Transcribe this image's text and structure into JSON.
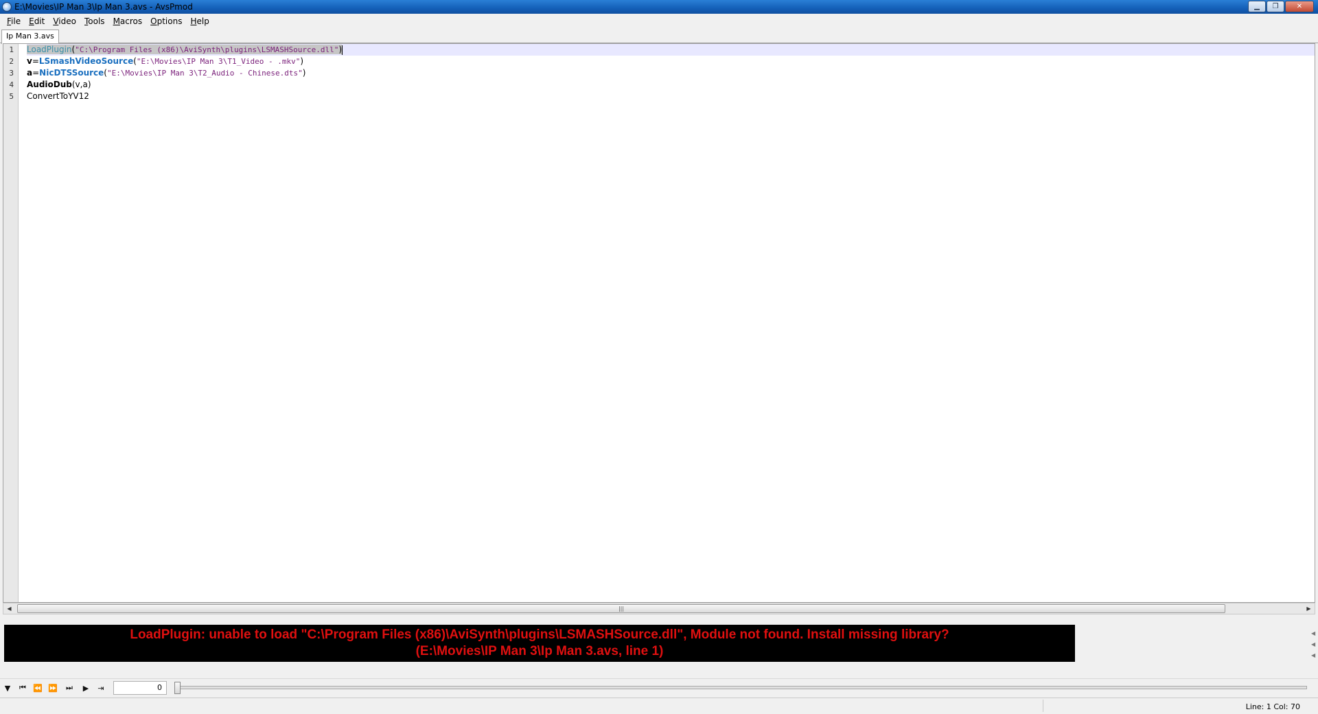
{
  "window": {
    "title": "E:\\Movies\\IP Man 3\\Ip Man 3.avs - AvsPmod",
    "buttons": {
      "minimize": "▁",
      "maximize": "❐",
      "close": "✕"
    }
  },
  "menu": {
    "items": [
      {
        "underline": "F",
        "rest": "ile"
      },
      {
        "underline": "E",
        "rest": "dit"
      },
      {
        "underline": "V",
        "rest": "ideo"
      },
      {
        "underline": "T",
        "rest": "ools"
      },
      {
        "underline": "M",
        "rest": "acros"
      },
      {
        "underline": "O",
        "rest": "ptions"
      },
      {
        "underline": "H",
        "rest": "elp"
      }
    ]
  },
  "tabs": [
    {
      "label": "Ip Man 3.avs",
      "active": true
    }
  ],
  "editor": {
    "line_numbers": [
      "1",
      "2",
      "3",
      "4",
      "5"
    ],
    "lines": [
      {
        "fn": "LoadPlugin",
        "open": "(",
        "str": "\"C:\\Program Files (x86)\\AviSynth\\plugins\\LSMASHSource.dll\"",
        "close": ")"
      },
      {
        "var": "v",
        "eq": "=",
        "fn": "LSmashVideoSource",
        "open": "(",
        "str": "\"E:\\Movies\\IP Man 3\\T1_Video - .mkv\"",
        "close": ")"
      },
      {
        "var": "a",
        "eq": "=",
        "fn": "NicDTSSource",
        "open": "(",
        "str": "\"E:\\Movies\\IP Man 3\\T2_Audio - Chinese.dts\"",
        "close": ")"
      },
      {
        "fn": "AudioDub",
        "args": "(v,a)"
      },
      {
        "plain": "ConvertToYV12"
      }
    ]
  },
  "error": {
    "line1": "LoadPlugin: unable to load \"C:\\Program Files (x86)\\AviSynth\\plugins\\LSMASHSource.dll\", Module not found.  Install missing library?",
    "line2": "(E:\\Movies\\IP Man 3\\Ip Man 3.avs, line 1)"
  },
  "playback": {
    "frame": "0",
    "icons": [
      "toggle-preview-icon",
      "first-frame-icon",
      "prev-frame-icon",
      "next-frame-icon",
      "last-frame-icon",
      "play-icon",
      "goto-frame-icon"
    ]
  },
  "status": {
    "position": "Line: 1   Col: 70"
  },
  "colors": {
    "error_text": "#e01010",
    "error_bg": "#000000",
    "string": "#7a1f7a",
    "function": "#1a6fbf"
  }
}
